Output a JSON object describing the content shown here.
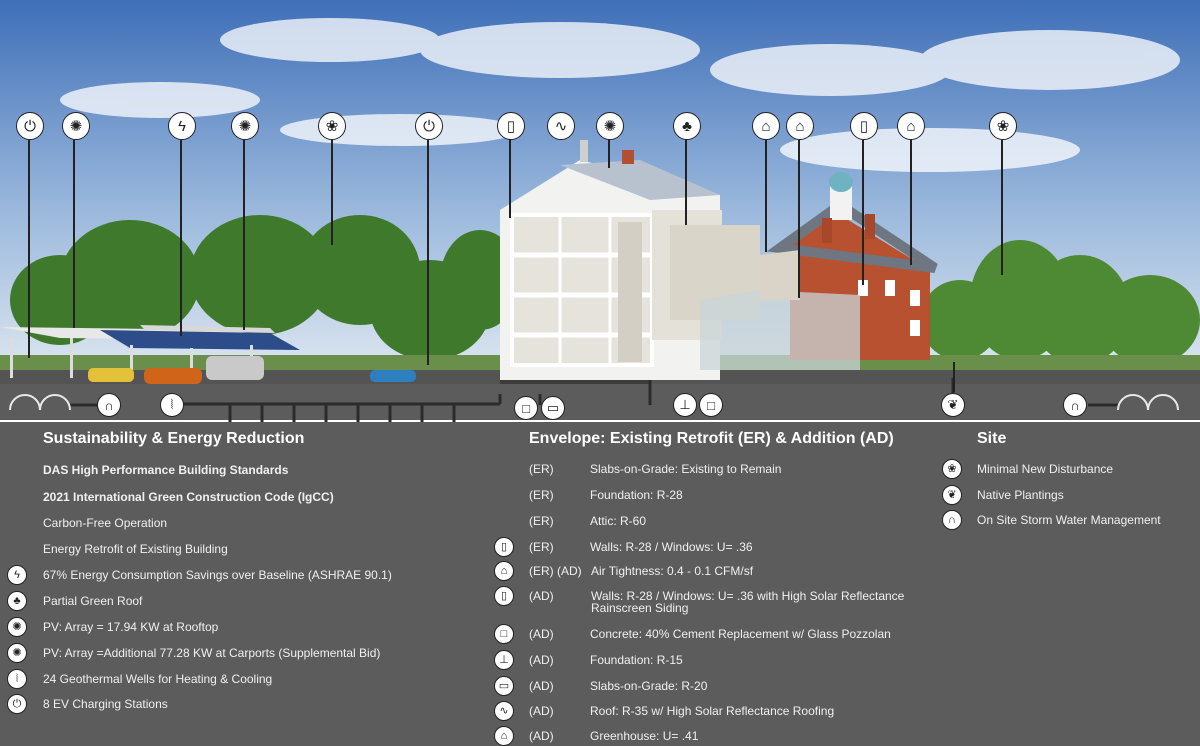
{
  "scene_icons": [
    {
      "name": "ev-charger-icon",
      "glyph": "⏻"
    },
    {
      "name": "pv-array-icon",
      "glyph": "✺"
    },
    {
      "name": "energy-savings-icon",
      "glyph": "ϟ"
    },
    {
      "name": "pv-array-icon",
      "glyph": "✺"
    },
    {
      "name": "tree-icon",
      "glyph": "❀"
    },
    {
      "name": "ev-charger-icon",
      "glyph": "⏻"
    },
    {
      "name": "walls-icon",
      "glyph": "▯"
    },
    {
      "name": "roof-icon",
      "glyph": "∿"
    },
    {
      "name": "pv-array-icon",
      "glyph": "✺"
    },
    {
      "name": "green-roof-icon",
      "glyph": "♣"
    },
    {
      "name": "air-tightness-icon",
      "glyph": "⌂"
    },
    {
      "name": "greenhouse-icon",
      "glyph": "⌂"
    },
    {
      "name": "walls-icon",
      "glyph": "▯"
    },
    {
      "name": "air-tightness-icon",
      "glyph": "⌂"
    },
    {
      "name": "tree-icon",
      "glyph": "❀"
    }
  ],
  "sustainability": {
    "title": "Sustainability & Energy Reduction",
    "items": [
      {
        "text": "DAS High Performance Building Standards",
        "bold": true,
        "icon": ""
      },
      {
        "text": "2021 International Green Construction Code (IgCC)",
        "bold": true,
        "icon": ""
      },
      {
        "text": "Carbon-Free Operation",
        "bold": false,
        "icon": ""
      },
      {
        "text": "Energy Retrofit of Existing Building",
        "bold": false,
        "icon": ""
      },
      {
        "text": "67% Energy Consumption Savings over Baseline (ASHRAE 90.1)",
        "bold": false,
        "icon": "ϟ"
      },
      {
        "text": "Partial Green Roof",
        "bold": false,
        "icon": "♣"
      },
      {
        "text": "PV: Array = 17.94 KW at Rooftop",
        "bold": false,
        "icon": "✺"
      },
      {
        "text": "PV: Array =Additional 77.28 KW at Carports (Supplemental Bid)",
        "bold": false,
        "icon": "✺"
      },
      {
        "text": "24 Geothermal Wells for Heating & Cooling",
        "bold": false,
        "icon": "⦚"
      },
      {
        "text": "8 EV Charging Stations",
        "bold": false,
        "icon": "⏻"
      }
    ]
  },
  "envelope": {
    "title": "Envelope: Existing Retrofit (ER) & Addition (AD)",
    "items": [
      {
        "tag": "(ER)",
        "text": "Slabs-on-Grade: Existing to Remain",
        "icon": ""
      },
      {
        "tag": "(ER)",
        "text": "Foundation: R-28",
        "icon": ""
      },
      {
        "tag": "(ER)",
        "text": "Attic: R-60",
        "icon": ""
      },
      {
        "tag": "(ER)",
        "text": "Walls: R-28 / Windows: U= .36",
        "icon": "▯"
      },
      {
        "tag": "(ER) (AD)",
        "text": "Air Tightness: 0.4 - 0.1 CFM/sf",
        "icon": "⌂"
      },
      {
        "tag": "(AD)",
        "text": "Walls: R-28 / Windows: U= .36 with High Solar Reflectance",
        "text2": "Rainscreen Siding",
        "icon": "▯"
      },
      {
        "tag": "(AD)",
        "text": "Concrete: 40% Cement Replacement w/ Glass Pozzolan",
        "icon": "□"
      },
      {
        "tag": "(AD)",
        "text": "Foundation: R-15",
        "icon": "⊥"
      },
      {
        "tag": "(AD)",
        "text": "Slabs-on-Grade: R-20",
        "icon": "▭"
      },
      {
        "tag": "(AD)",
        "text": "Roof: R-35 w/ High Solar Reflectance Roofing",
        "icon": "∿"
      },
      {
        "tag": "(AD)",
        "text": "Greenhouse: U= .41",
        "icon": "⌂"
      }
    ]
  },
  "site": {
    "title": "Site",
    "items": [
      {
        "text": "Minimal New Disturbance",
        "icon": "❀"
      },
      {
        "text": "Native Plantings",
        "icon": "❦"
      },
      {
        "text": "On Site Storm Water Management",
        "icon": "∩"
      }
    ]
  },
  "colors": {
    "sky_top": "#3f6fb8",
    "sky_bottom": "#cfdcec",
    "panel": "#5c5c5c",
    "brick": "#b8512f",
    "tree": "#3f7a2c"
  }
}
